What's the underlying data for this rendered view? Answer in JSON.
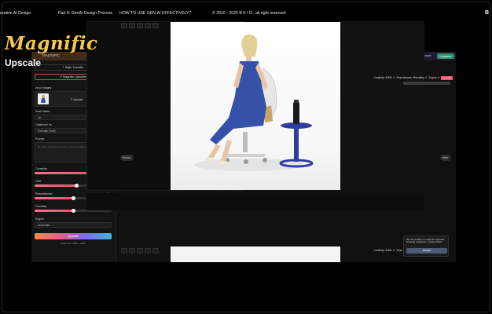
{
  "topbar": {
    "course": "erative AI Design",
    "part": "Part 8: GenAI Design Process",
    "lesson": "HOW TO USE GEN-AI EFFECTIVELY?",
    "copyright": "© 2010 - 2025 B K I D., all right reserved",
    "logo_letter": "B"
  },
  "brand": {
    "title": "Magnific",
    "subtitle": "Upscale"
  },
  "app": {
    "logo": "MAGNIFIC",
    "nav": [
      "Tutorials",
      "FAQ",
      "Account"
    ],
    "upgrade_label": "Upgrade"
  },
  "sidebar": {
    "style_transfer": "+ Style Transfer",
    "magnific_upscaler": "↗ Magnific Upscaler",
    "input_images_label": "Input Images",
    "upload_label": "⇪ Upload",
    "scale_factor_label": "Scale factor",
    "scale_factor_value": "4x",
    "optimized_for_label": "Optimized for",
    "optimized_for_value": "Portraits (Soft)",
    "prompt_label": "Prompt",
    "prompt_placeholder": "Describe anything you wish to drive the generation",
    "creativity_label": "Creativity",
    "creativity_value": "3",
    "creativity_level": 0.75,
    "hdr_label": "HDR",
    "hdr_value": "3",
    "hdr_level": 0.55,
    "resemblance_label": "Resemblance",
    "resemblance_value": "3",
    "resemblance_level": 0.5,
    "fractality_label": "Fractality",
    "fractality_value": "2",
    "fractality_level": 0.5,
    "engine_label": "Engine",
    "engine_value": "Automatic",
    "upscale_button": "Upscale",
    "cost_text": "Final Size: 4096 x 4096"
  },
  "canvas": {
    "chips": [
      "Grid view",
      "Save",
      "Tags",
      "All upscale"
    ],
    "before_label": "Before",
    "after_label": "After",
    "right_chips": [
      "Creativity: 3",
      "HDR: 3",
      "Resemblance: 3",
      "Fractality: 2",
      "Engine: A",
      "Upscale"
    ],
    "bottom_chips": [
      "Creativity: 3",
      "HDR: 3",
      "Rese"
    ]
  },
  "cookie": {
    "text": "We use cookies to enable an improved browsing experience. Cookies Policy",
    "accept_label": "Accept"
  },
  "colors": {
    "brand_yellow": "#f2c94c",
    "accent_pink": "#ff4d6d",
    "upgrade_green": "#2f8f6a",
    "dress_blue": "#3552a8"
  }
}
